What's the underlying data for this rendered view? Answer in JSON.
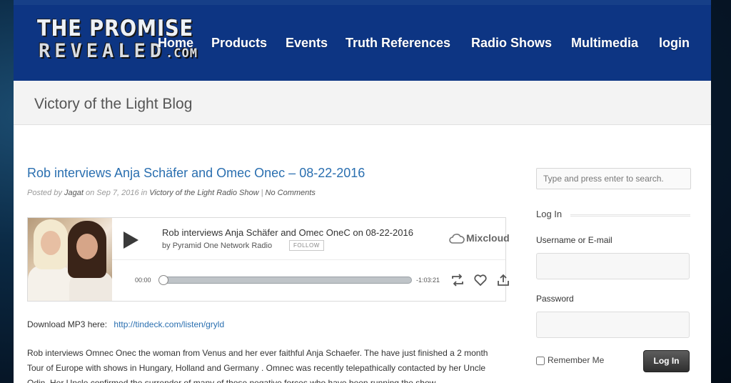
{
  "site": {
    "logo_line1": "THE PROMISE",
    "logo_line2": "REVEALED",
    "logo_suffix": ".COM"
  },
  "nav": {
    "items": [
      "Home",
      "Products",
      "Events",
      "Truth References",
      "Radio Shows",
      "Multimedia",
      "login"
    ]
  },
  "page": {
    "title": "Victory of the Light Blog"
  },
  "post": {
    "title": "Rob interviews Anja Schäfer and Omec Onec – 08-22-2016",
    "meta_prefix": "Posted by",
    "author": "Jagat",
    "meta_on": "on Sep 7, 2016 in",
    "category": "Victory of the Light Radio Show",
    "separator": "|",
    "comments": "No Comments",
    "download_label": "Download MP3 here:",
    "download_link": "http://tindeck.com/listen/gryld",
    "body": "Rob interviews Omnec Onec the woman from Venus and her ever faithful Anja Schaefer. The have just finished a 2 month Tour of Europe with shows in Hungary, Holland and Germany . Omnec was recently telepathically contacted by her Uncle Odin. Her Uncle confirmed the surrender of many of those negative forces who have been running the show"
  },
  "player": {
    "track_title": "Rob interviews Anja Schäfer and Omec OneC on 08-22-2016",
    "by_prefix": "by",
    "artist": "Pyramid One Network Radio",
    "follow_label": "FOLLOW",
    "brand": "Mixcloud",
    "time_start": "00:00",
    "time_end": "-1:03:21",
    "progress_fraction": 0.0
  },
  "sidebar": {
    "search_placeholder": "Type and press enter to search.",
    "login_title": "Log In",
    "username_label": "Username or E-mail",
    "password_label": "Password",
    "remember_label": "Remember Me",
    "login_button": "Log In"
  },
  "colors": {
    "header_blue": "#0d3583",
    "link_blue": "#2a6fb0"
  }
}
